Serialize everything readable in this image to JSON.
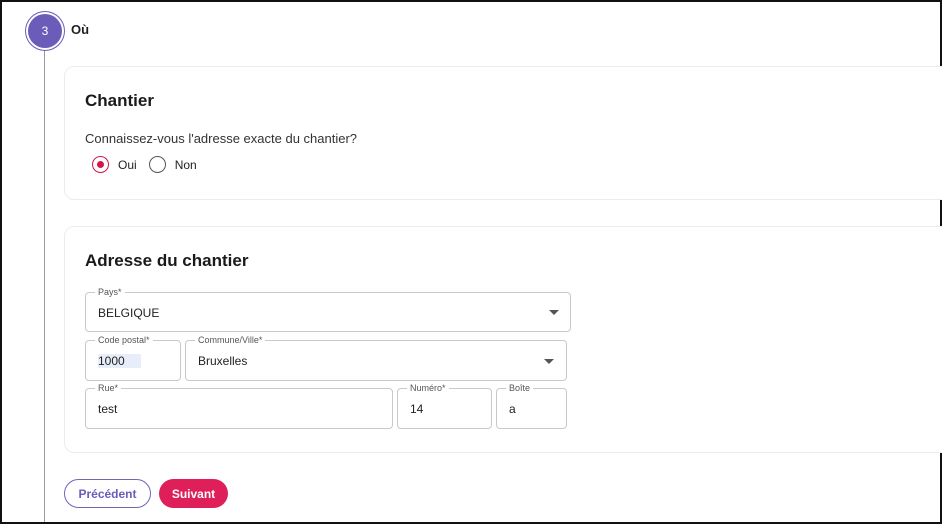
{
  "step": {
    "number": "3",
    "label": "Où"
  },
  "chantier": {
    "title": "Chantier",
    "question": "Connaissez-vous l'adresse exacte du chantier?",
    "options": [
      {
        "label": "Oui",
        "checked": true
      },
      {
        "label": "Non",
        "checked": false
      }
    ]
  },
  "adresse": {
    "title": "Adresse du chantier",
    "pays": {
      "label": "Pays*",
      "value": "BELGIQUE"
    },
    "code_postal": {
      "label": "Code postal*",
      "value": "1000"
    },
    "commune": {
      "label": "Commune/Ville*",
      "value": "Bruxelles"
    },
    "rue": {
      "label": "Rue*",
      "value": "test"
    },
    "numero": {
      "label": "Numéro*",
      "value": "14"
    },
    "boite": {
      "label": "Boîte",
      "value": "a"
    }
  },
  "buttons": {
    "prev": "Précédent",
    "next": "Suivant"
  },
  "colors": {
    "step": "#6a5cb8",
    "accent": "#de1f5a",
    "radio_checked": "#d6154a"
  }
}
